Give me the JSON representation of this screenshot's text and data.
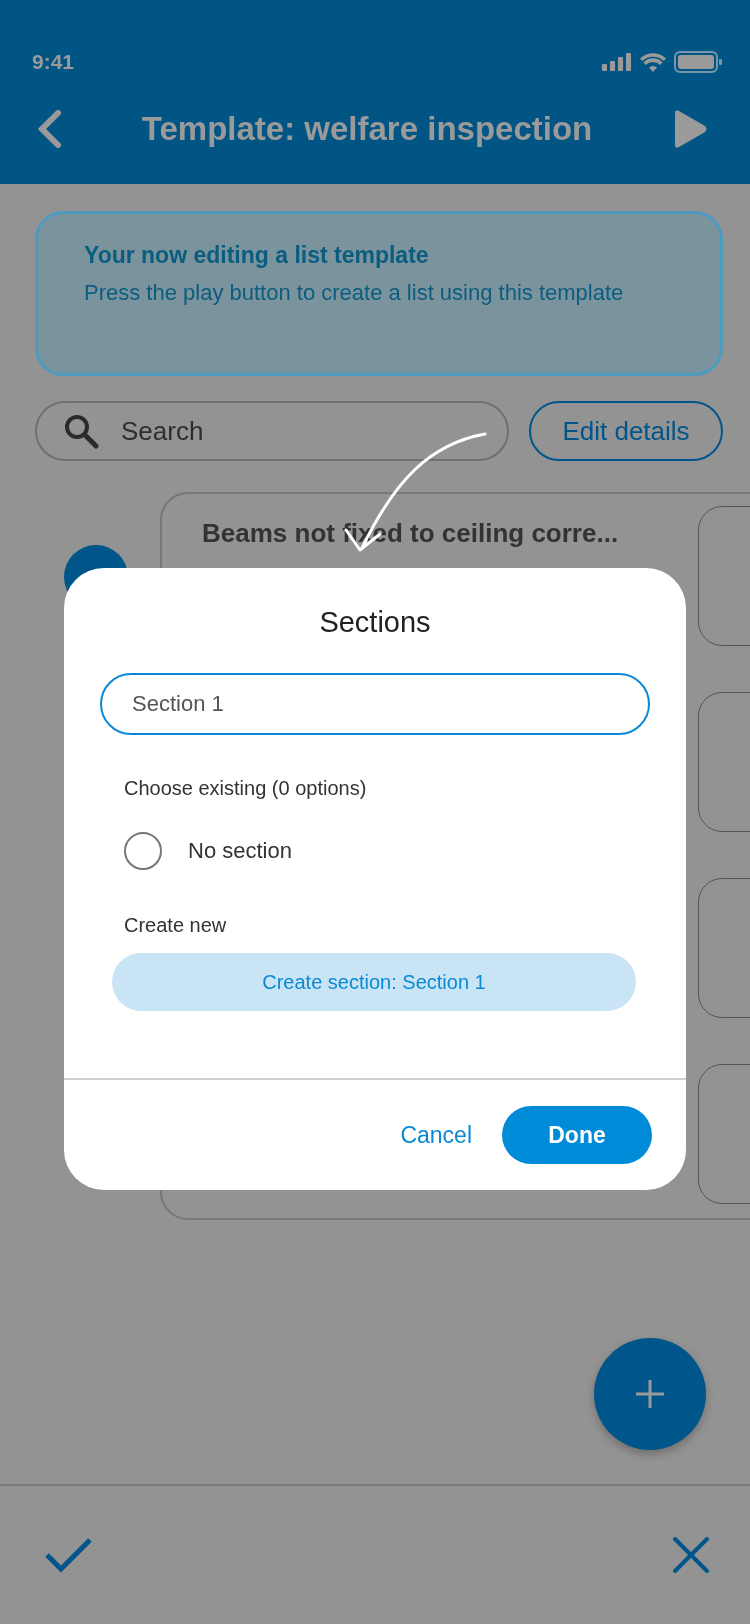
{
  "status_bar": {
    "time": "9:41"
  },
  "header": {
    "title": "Template: welfare inspection"
  },
  "banner": {
    "title": "Your now editing a list template",
    "text": "Press the play button to create a list using this template"
  },
  "search": {
    "placeholder": "Search"
  },
  "edit_button": "Edit details",
  "list_card": {
    "title": "Beams not fixed to ceiling corre..."
  },
  "dialog": {
    "title": "Sections",
    "input_value": "Section 1",
    "existing_label": "Choose existing (0 options)",
    "options": [
      {
        "label": "No section",
        "selected": false
      }
    ],
    "create_label": "Create new",
    "create_button": "Create section: Section 1",
    "cancel": "Cancel",
    "done": "Done"
  }
}
